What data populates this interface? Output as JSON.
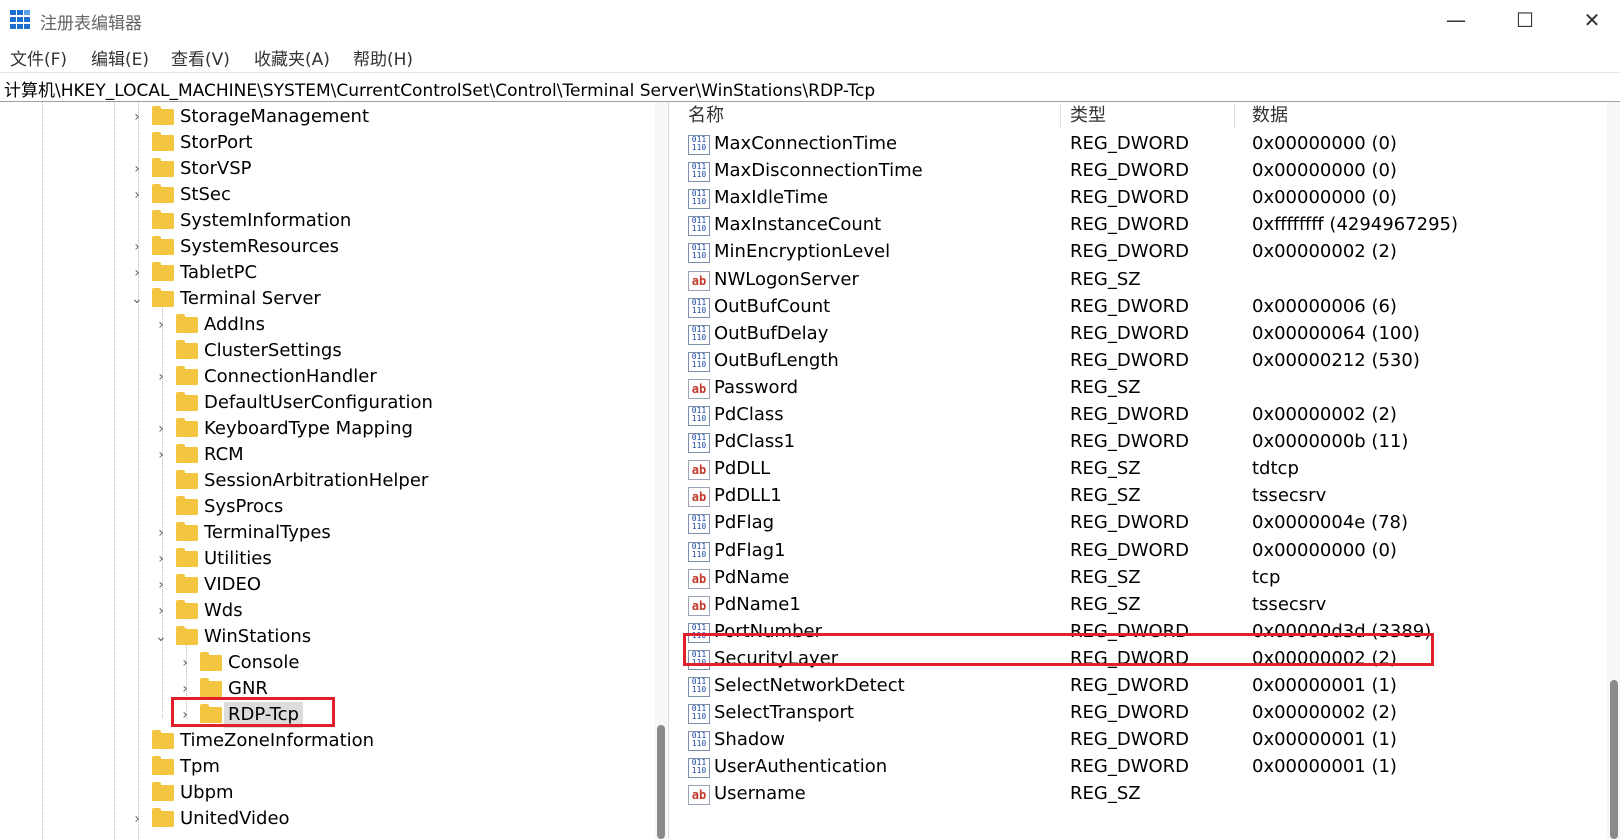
{
  "window": {
    "title": "注册表编辑器",
    "minimize": "—",
    "maximize": "☐",
    "close": "✕"
  },
  "menu": [
    "文件(F)",
    "编辑(E)",
    "查看(V)",
    "收藏夹(A)",
    "帮助(H)"
  ],
  "address": "计算机\\HKEY_LOCAL_MACHINE\\SYSTEM\\CurrentControlSet\\Control\\Terminal Server\\WinStations\\RDP-Tcp",
  "tree": [
    {
      "label": "StorageManagement",
      "level": 0,
      "expander": "collapsed"
    },
    {
      "label": "StorPort",
      "level": 0,
      "expander": "none"
    },
    {
      "label": "StorVSP",
      "level": 0,
      "expander": "collapsed"
    },
    {
      "label": "StSec",
      "level": 0,
      "expander": "collapsed"
    },
    {
      "label": "SystemInformation",
      "level": 0,
      "expander": "none"
    },
    {
      "label": "SystemResources",
      "level": 0,
      "expander": "collapsed"
    },
    {
      "label": "TabletPC",
      "level": 0,
      "expander": "collapsed"
    },
    {
      "label": "Terminal Server",
      "level": 0,
      "expander": "expanded"
    },
    {
      "label": "AddIns",
      "level": 1,
      "expander": "collapsed"
    },
    {
      "label": "ClusterSettings",
      "level": 1,
      "expander": "none"
    },
    {
      "label": "ConnectionHandler",
      "level": 1,
      "expander": "collapsed"
    },
    {
      "label": "DefaultUserConfiguration",
      "level": 1,
      "expander": "none"
    },
    {
      "label": "KeyboardType Mapping",
      "level": 1,
      "expander": "collapsed"
    },
    {
      "label": "RCM",
      "level": 1,
      "expander": "collapsed"
    },
    {
      "label": "SessionArbitrationHelper",
      "level": 1,
      "expander": "none"
    },
    {
      "label": "SysProcs",
      "level": 1,
      "expander": "none"
    },
    {
      "label": "TerminalTypes",
      "level": 1,
      "expander": "collapsed"
    },
    {
      "label": "Utilities",
      "level": 1,
      "expander": "collapsed"
    },
    {
      "label": "VIDEO",
      "level": 1,
      "expander": "collapsed"
    },
    {
      "label": "Wds",
      "level": 1,
      "expander": "collapsed"
    },
    {
      "label": "WinStations",
      "level": 1,
      "expander": "expanded"
    },
    {
      "label": "Console",
      "level": 2,
      "expander": "collapsed"
    },
    {
      "label": "GNR",
      "level": 2,
      "expander": "collapsed"
    },
    {
      "label": "RDP-Tcp",
      "level": 2,
      "expander": "collapsed",
      "selected": true
    },
    {
      "label": "TimeZoneInformation",
      "level": 0,
      "expander": "none"
    },
    {
      "label": "Tpm",
      "level": 0,
      "expander": "none"
    },
    {
      "label": "Ubpm",
      "level": 0,
      "expander": "none"
    },
    {
      "label": "UnitedVideo",
      "level": 0,
      "expander": "collapsed"
    }
  ],
  "list": {
    "headers": {
      "name": "名称",
      "type": "类型",
      "data": "数据"
    },
    "rows": [
      {
        "name": "MaxConnectionTime",
        "type": "REG_DWORD",
        "data": "0x00000000 (0)",
        "icon": "dword-value-icon"
      },
      {
        "name": "MaxDisconnectionTime",
        "type": "REG_DWORD",
        "data": "0x00000000 (0)",
        "icon": "dword-value-icon"
      },
      {
        "name": "MaxIdleTime",
        "type": "REG_DWORD",
        "data": "0x00000000 (0)",
        "icon": "dword-value-icon"
      },
      {
        "name": "MaxInstanceCount",
        "type": "REG_DWORD",
        "data": "0xffffffff (4294967295)",
        "icon": "dword-value-icon"
      },
      {
        "name": "MinEncryptionLevel",
        "type": "REG_DWORD",
        "data": "0x00000002 (2)",
        "icon": "dword-value-icon"
      },
      {
        "name": "NWLogonServer",
        "type": "REG_SZ",
        "data": "",
        "icon": "string-value-icon"
      },
      {
        "name": "OutBufCount",
        "type": "REG_DWORD",
        "data": "0x00000006 (6)",
        "icon": "dword-value-icon"
      },
      {
        "name": "OutBufDelay",
        "type": "REG_DWORD",
        "data": "0x00000064 (100)",
        "icon": "dword-value-icon"
      },
      {
        "name": "OutBufLength",
        "type": "REG_DWORD",
        "data": "0x00000212 (530)",
        "icon": "dword-value-icon"
      },
      {
        "name": "Password",
        "type": "REG_SZ",
        "data": "",
        "icon": "string-value-icon"
      },
      {
        "name": "PdClass",
        "type": "REG_DWORD",
        "data": "0x00000002 (2)",
        "icon": "dword-value-icon"
      },
      {
        "name": "PdClass1",
        "type": "REG_DWORD",
        "data": "0x0000000b (11)",
        "icon": "dword-value-icon"
      },
      {
        "name": "PdDLL",
        "type": "REG_SZ",
        "data": "tdtcp",
        "icon": "string-value-icon"
      },
      {
        "name": "PdDLL1",
        "type": "REG_SZ",
        "data": "tssecsrv",
        "icon": "string-value-icon"
      },
      {
        "name": "PdFlag",
        "type": "REG_DWORD",
        "data": "0x0000004e (78)",
        "icon": "dword-value-icon"
      },
      {
        "name": "PdFlag1",
        "type": "REG_DWORD",
        "data": "0x00000000 (0)",
        "icon": "dword-value-icon"
      },
      {
        "name": "PdName",
        "type": "REG_SZ",
        "data": "tcp",
        "icon": "string-value-icon"
      },
      {
        "name": "PdName1",
        "type": "REG_SZ",
        "data": "tssecsrv",
        "icon": "string-value-icon"
      },
      {
        "name": "PortNumber",
        "type": "REG_DWORD",
        "data": "0x00000d3d (3389)",
        "icon": "dword-value-icon",
        "highlighted": true
      },
      {
        "name": "SecurityLayer",
        "type": "REG_DWORD",
        "data": "0x00000002 (2)",
        "icon": "dword-value-icon"
      },
      {
        "name": "SelectNetworkDetect",
        "type": "REG_DWORD",
        "data": "0x00000001 (1)",
        "icon": "dword-value-icon"
      },
      {
        "name": "SelectTransport",
        "type": "REG_DWORD",
        "data": "0x00000002 (2)",
        "icon": "dword-value-icon"
      },
      {
        "name": "Shadow",
        "type": "REG_DWORD",
        "data": "0x00000001 (1)",
        "icon": "dword-value-icon"
      },
      {
        "name": "UserAuthentication",
        "type": "REG_DWORD",
        "data": "0x00000001 (1)",
        "icon": "dword-value-icon"
      },
      {
        "name": "Username",
        "type": "REG_SZ",
        "data": "",
        "icon": "string-value-icon"
      }
    ]
  },
  "icon_glyphs": {
    "dword": "011\n110",
    "string": "ab",
    "collapsed": "›",
    "expanded": "⌄"
  },
  "colors": {
    "highlight_box": "#e0202a",
    "folder": "#f4c540",
    "selection": "#dcdcdc"
  }
}
